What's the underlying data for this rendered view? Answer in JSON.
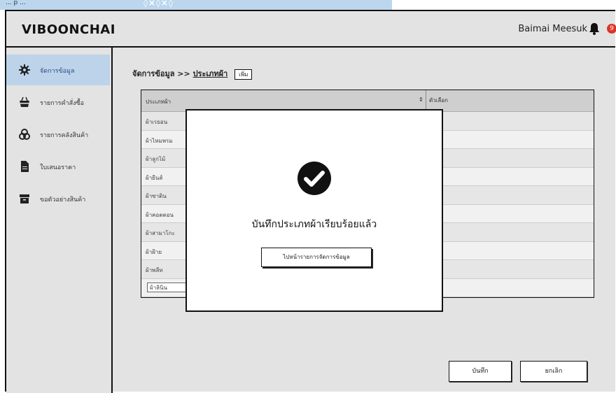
{
  "browser": {
    "caption": "... p ...",
    "ornament": "◊×◊×◊"
  },
  "app": {
    "brand": "VIBOONCHAI",
    "user_name": "Baimai Meesuk",
    "notification_count": "9"
  },
  "sidebar": {
    "items": [
      {
        "label": "จัดการข้อมูล",
        "icon": "gear-icon",
        "active": true
      },
      {
        "label": "รายการคำสั่งซื้อ",
        "icon": "basket-icon",
        "active": false
      },
      {
        "label": "รายการคลังสินค้า",
        "icon": "boxes-icon",
        "active": false
      },
      {
        "label": "ใบเสนอราคา",
        "icon": "document-icon",
        "active": false
      },
      {
        "label": "ขอตัวอย่างสินค้า",
        "icon": "archive-icon",
        "active": false
      }
    ]
  },
  "breadcrumb": {
    "root": "จัดการข้อมูล",
    "sep": ">>",
    "current": "ประเภทผ้า",
    "add_label": "เพิ่ม"
  },
  "table": {
    "col1": "ประเภทผ้า",
    "sort": "⇕",
    "col2": "ตัวเลือก",
    "rows": [
      "ผ้าเรยอน",
      "ผ้าไหมพรม",
      "ผ้าลูกไม้",
      "ผ้ายีนส์",
      "ผ้าซาติน",
      "ผ้าคอตตอน",
      "ผ้าสามาโกะ",
      "ผ้าฝ้าย",
      "ผ้าพลีท"
    ],
    "edit_value": "ผ้าลินิน"
  },
  "actions": {
    "save": "บันทึก",
    "cancel": "ยกเลิก"
  },
  "modal": {
    "message": "บันทึกประเภทผ้าเรียบร้อยแล้ว",
    "button": "ไปหน้ารายการจัดการข้อมูล",
    "icon": "check-circle-icon"
  },
  "colors": {
    "active_bg": "#bcd3ea",
    "badge": "#d9362b"
  }
}
